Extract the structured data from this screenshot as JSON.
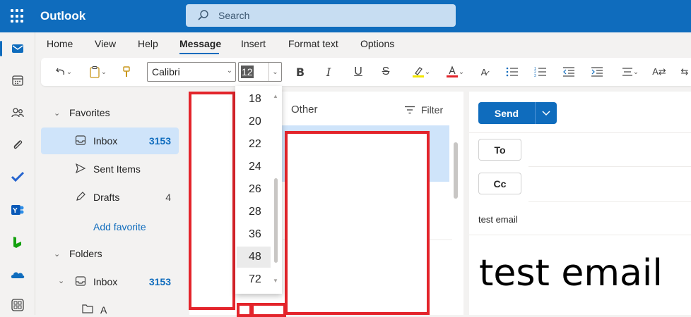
{
  "app": {
    "title": "Outlook"
  },
  "search": {
    "placeholder": "Search"
  },
  "tabs": [
    {
      "label": "Home"
    },
    {
      "label": "View"
    },
    {
      "label": "Help"
    },
    {
      "label": "Message"
    },
    {
      "label": "Insert"
    },
    {
      "label": "Format text"
    },
    {
      "label": "Options"
    }
  ],
  "ribbon": {
    "font": "Calibri",
    "font_size": "12"
  },
  "font_size_dropdown": {
    "options": [
      "18",
      "20",
      "22",
      "24",
      "26",
      "28",
      "36",
      "48",
      "72"
    ],
    "highlighted": "48"
  },
  "folders": {
    "favorites_label": "Favorites",
    "favorites": [
      {
        "label": "Inbox",
        "count": "3153"
      },
      {
        "label": "Sent Items",
        "count": ""
      },
      {
        "label": "Drafts",
        "count": "4"
      }
    ],
    "add_favorite": "Add favorite",
    "folders_label": "Folders",
    "inbox": {
      "label": "Inbox",
      "count": "3153"
    },
    "sub_folder": "A"
  },
  "message_list": {
    "tab_other": "Other",
    "filter": "Filter"
  },
  "compose": {
    "send": "Send",
    "to": "To",
    "cc": "Cc",
    "subject": "test email",
    "body": "test email"
  },
  "colors": {
    "brand": "#0f6cbd",
    "selected": "#cfe4fa",
    "redaction": "#e3242b"
  }
}
